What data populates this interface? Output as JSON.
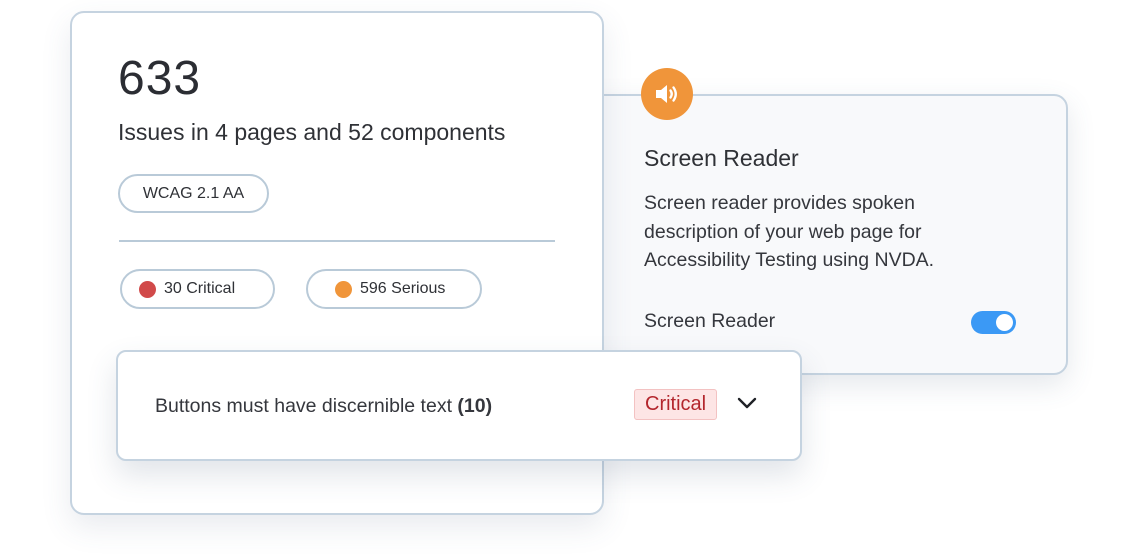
{
  "screen_reader_card": {
    "icon": "speaker-icon",
    "title": "Screen Reader",
    "description": "Screen reader provides spoken description of your web page for Accessibility Testing using NVDA.",
    "toggle_label": "Screen Reader",
    "toggle_on": true,
    "accent_color": "#f0953a",
    "toggle_color": "#3b99f5"
  },
  "issues_card": {
    "total": "633",
    "subtitle": "Issues in 4 pages and 52 components",
    "standard": "WCAG 2.1 AA",
    "severity_counts": [
      {
        "label": "30 Critical",
        "color": "#d14a4a"
      },
      {
        "label": "596 Serious",
        "color": "#f0953a"
      }
    ]
  },
  "issue_row": {
    "text": "Buttons must have discernible text",
    "count": "(10)",
    "severity": "Critical",
    "icon": "chevron-down-icon"
  }
}
